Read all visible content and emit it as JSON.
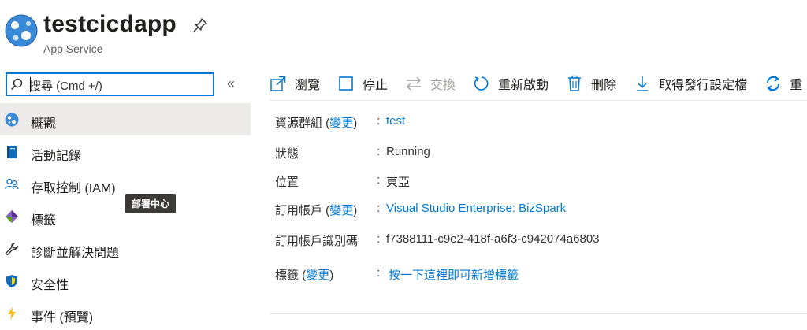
{
  "header": {
    "title": "testcicdapp",
    "subtitle": "App Service"
  },
  "sidebar": {
    "search_value": "搜尋 (Cmd +/)",
    "collapse_glyph": "«",
    "items": [
      {
        "label": "概觀",
        "icon": "app-service-icon",
        "active": true
      },
      {
        "label": "活動記錄",
        "icon": "activity-log-icon"
      },
      {
        "label": "存取控制 (IAM)",
        "icon": "people-icon"
      },
      {
        "label": "標籤",
        "icon": "tag-icon"
      },
      {
        "label": "診斷並解決問題",
        "icon": "wrench-icon"
      },
      {
        "label": "安全性",
        "icon": "shield-icon"
      },
      {
        "label": "事件 (預覽)",
        "icon": "lightning-icon"
      }
    ],
    "tooltip": "部署中心"
  },
  "toolbar": {
    "browse": "瀏覽",
    "stop": "停止",
    "swap": "交換",
    "restart": "重新啟動",
    "delete": "刪除",
    "get_profile": "取得發行設定檔",
    "reset": "重"
  },
  "essentials": {
    "resource_group": {
      "label": "資源群組",
      "change": "變更",
      "value": "test"
    },
    "status": {
      "label": "狀態",
      "value": "Running"
    },
    "location": {
      "label": "位置",
      "value": "東亞"
    },
    "subscription": {
      "label": "訂用帳戶",
      "change": "變更",
      "value": "Visual Studio Enterprise: BizSpark"
    },
    "subscription_id": {
      "label": "訂用帳戶識別碼",
      "value": "f7388111-c9e2-418f-a6f3-c942074a6803"
    },
    "tags": {
      "label": "標籤",
      "change": "變更",
      "value": "按一下這裡即可新增標籤"
    },
    "colon": ":"
  },
  "colors": {
    "accent": "#0078d4",
    "active_bg": "#edebe9",
    "tooltip_bg": "#3b3a39"
  }
}
